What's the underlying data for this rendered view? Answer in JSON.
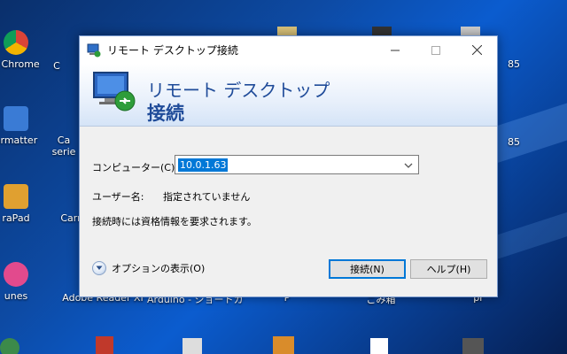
{
  "desktop": {
    "icons": [
      {
        "label": "e Chrome"
      },
      {
        "label": "C"
      },
      {
        "label": "ormatter"
      },
      {
        "label": "Ca"
      },
      {
        "label": "serie"
      },
      {
        "label": "raPad"
      },
      {
        "label": "Carr"
      },
      {
        "label": "unes"
      },
      {
        "label": "Adobe Reader XI"
      },
      {
        "label": "Arduino - ショートカット"
      },
      {
        "label": "P"
      },
      {
        "label": "ごみ箱"
      },
      {
        "label": "pr"
      },
      {
        "label": "85"
      },
      {
        "label": "85"
      }
    ]
  },
  "dialog": {
    "title": "リモート デスクトップ接続",
    "banner_line1": "リモート デスクトップ",
    "banner_line2": "接続",
    "computer_label": "コンピューター(C):",
    "computer_value": "10.0.1.63",
    "username_label": "ユーザー名:",
    "username_value": "指定されていません",
    "credentials_note": "接続時には資格情報を要求されます。",
    "options_label": "オプションの表示(O)",
    "connect_label": "接続(N)",
    "help_label": "ヘルプ(H)"
  }
}
